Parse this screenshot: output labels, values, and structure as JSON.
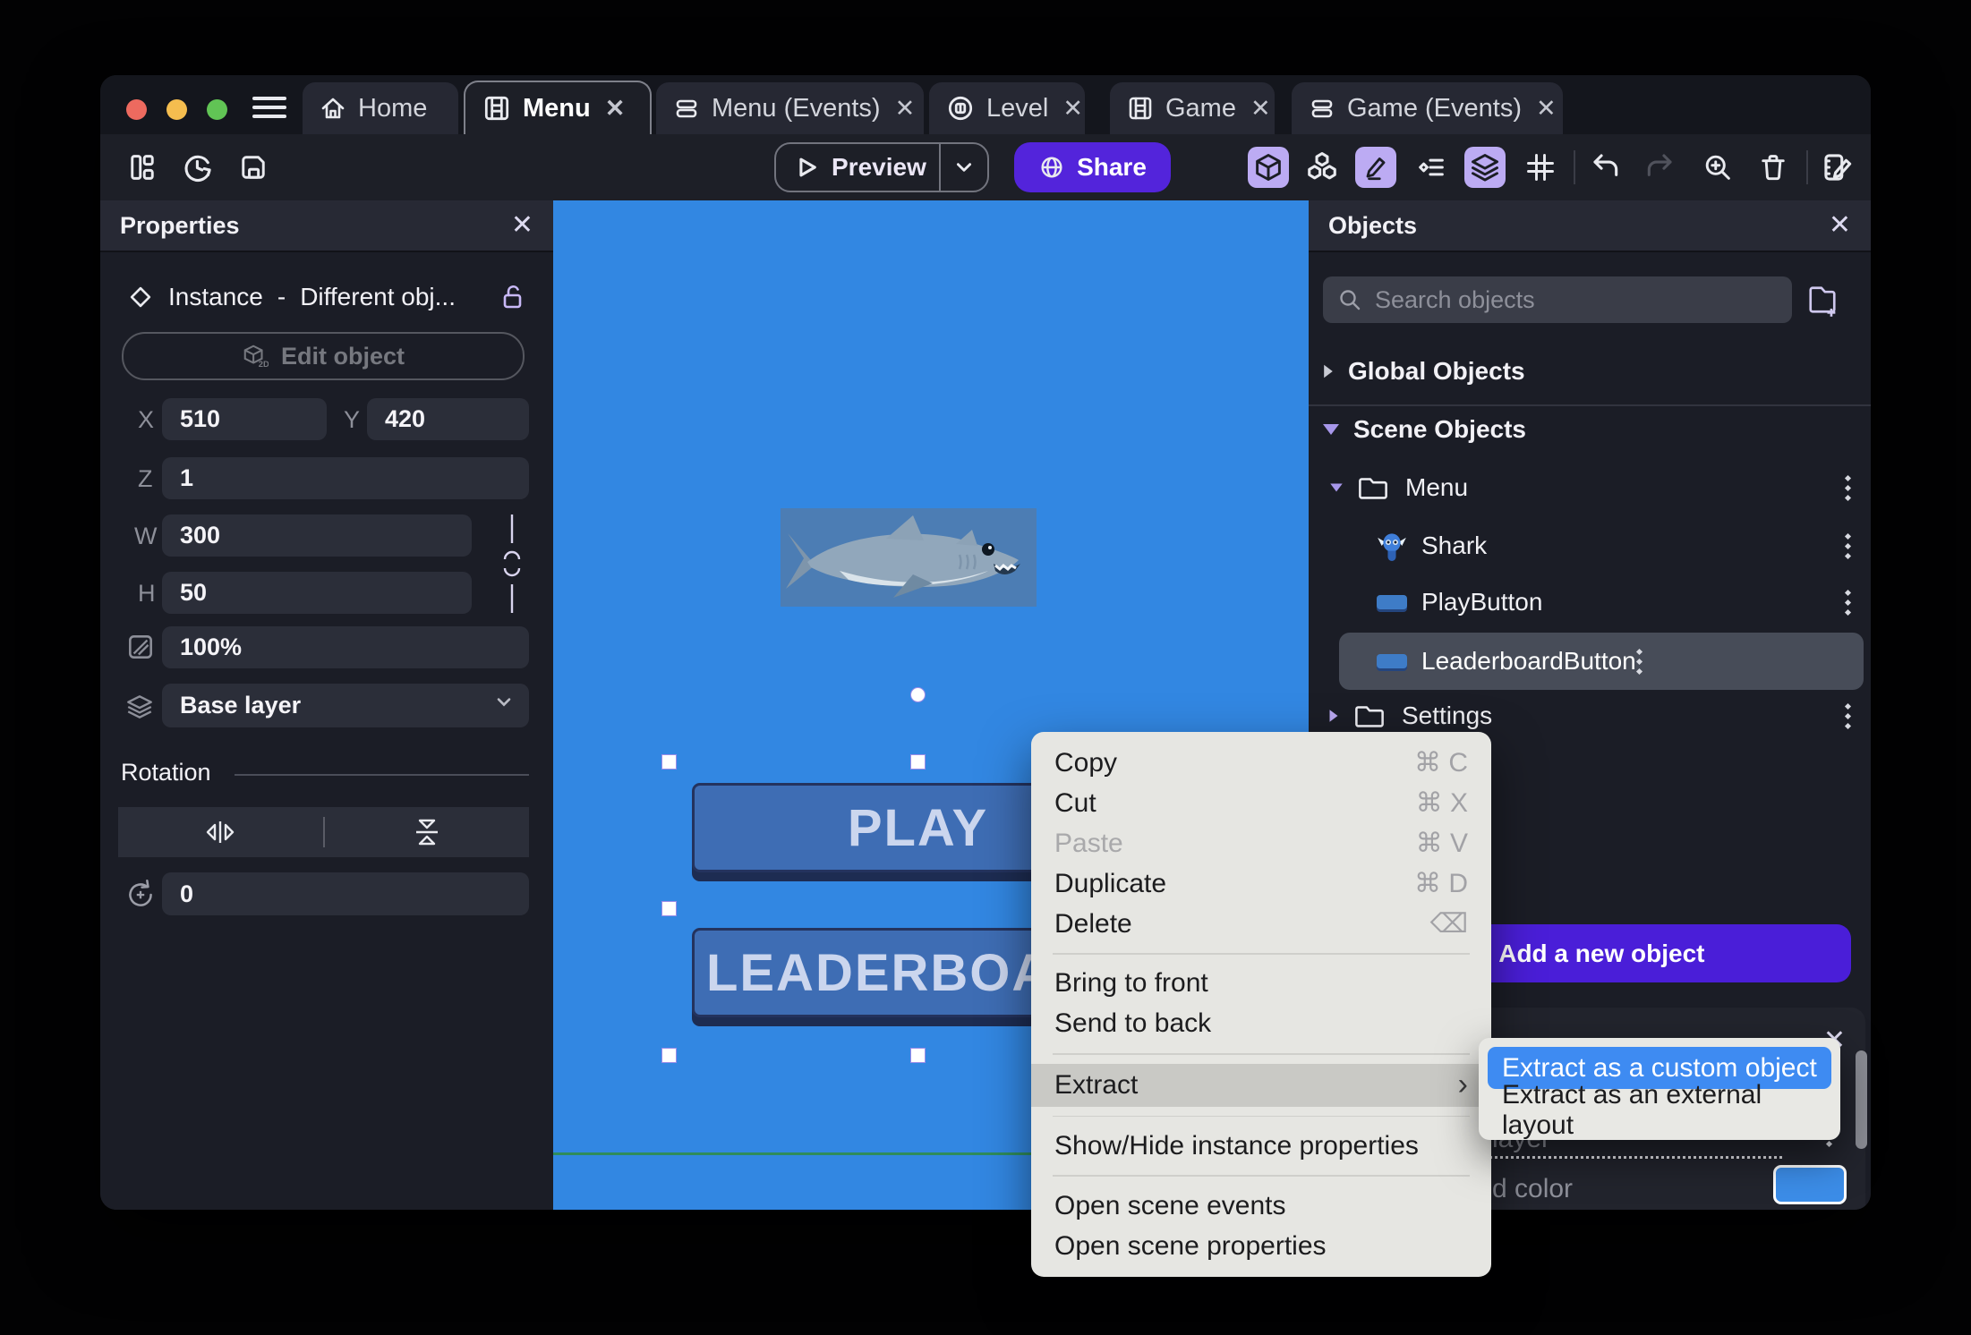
{
  "tabs": [
    {
      "label": "Home"
    },
    {
      "label": "Menu"
    },
    {
      "label": "Menu (Events)"
    },
    {
      "label": "Level"
    },
    {
      "label": "Game"
    },
    {
      "label": "Game (Events)"
    }
  ],
  "toolbar": {
    "preview": "Preview",
    "share": "Share"
  },
  "properties": {
    "title": "Properties",
    "instance": "Instance",
    "instance_sep": "-",
    "instance_name": "Different obj...",
    "edit_object": "Edit object",
    "x_label": "X",
    "x": "510",
    "y_label": "Y",
    "y": "420",
    "z_label": "Z",
    "z": "1",
    "w_label": "W",
    "w": "300",
    "h_label": "H",
    "h": "50",
    "opacity": "100%",
    "layer": "Base layer",
    "rotation_title": "Rotation",
    "rotation": "0"
  },
  "canvas": {
    "play": "PLAY",
    "leaderboard": "LEADERBOARD"
  },
  "objects": {
    "title": "Objects",
    "search_placeholder": "Search objects",
    "global_label": "Global Objects",
    "scene_label": "Scene Objects",
    "tree": {
      "menu": "Menu",
      "shark": "Shark",
      "play": "PlayButton",
      "leaderboard": "LeaderboardButton",
      "settings": "Settings"
    },
    "add_button": "Add a new object"
  },
  "context_menu": {
    "items": [
      {
        "label": "Copy",
        "shortcut": "⌘ C"
      },
      {
        "label": "Cut",
        "shortcut": "⌘ X"
      },
      {
        "label": "Paste",
        "shortcut": "⌘ V",
        "disabled": true
      },
      {
        "label": "Duplicate",
        "shortcut": "⌘ D"
      },
      {
        "label": "Delete",
        "shortcut": "⌫"
      },
      {
        "label": "Bring to front"
      },
      {
        "label": "Send to back"
      },
      {
        "label": "Extract"
      },
      {
        "label": "Show/Hide instance properties"
      },
      {
        "label": "Open scene events"
      },
      {
        "label": "Open scene properties"
      }
    ]
  },
  "extract_submenu": {
    "items": [
      {
        "label": "Extract as a custom object",
        "highlighted": true
      },
      {
        "label": "Extract as an external layout"
      }
    ]
  },
  "bottom_panel": {
    "layer_text": "layer",
    "color_text": "d color"
  },
  "colors": {
    "accent_purple": "#4A1ED8",
    "toolbar_active": "#BCABF3",
    "canvas_blue": "#3287E2",
    "scene_button_blue": "#3E6DB4",
    "submenu_highlight": "#3E8BF2",
    "swatch_blue": "#3C8DE8",
    "green_guide": "#2F8C5B"
  }
}
